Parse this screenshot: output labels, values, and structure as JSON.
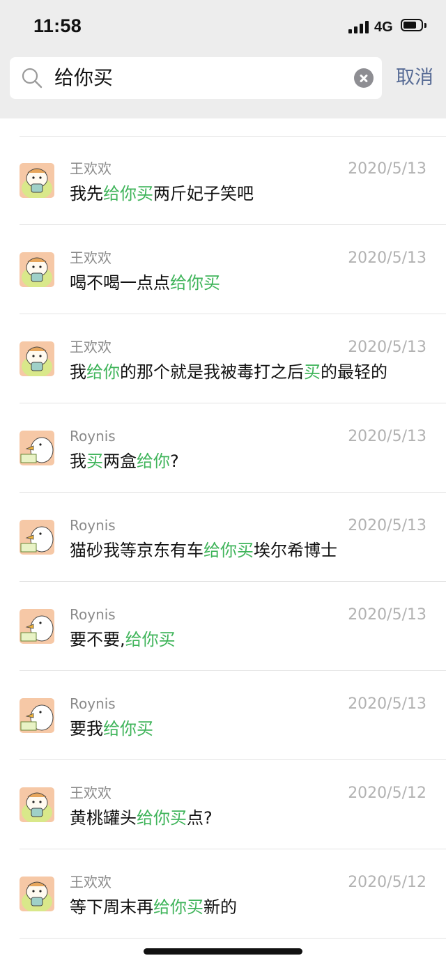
{
  "status": {
    "time": "11:58",
    "network": "4G"
  },
  "search": {
    "query": "给你买",
    "cancel_label": "取消"
  },
  "results": [
    {
      "sender": "王欢欢",
      "avatar": "hamster-avatar",
      "date": "2020/5/13",
      "segments": [
        {
          "t": "我先",
          "h": false
        },
        {
          "t": "给你买",
          "h": true
        },
        {
          "t": "两斤妃子笑吧",
          "h": false
        }
      ]
    },
    {
      "sender": "王欢欢",
      "avatar": "hamster-avatar",
      "date": "2020/5/13",
      "segments": [
        {
          "t": "喝不喝一点点",
          "h": false
        },
        {
          "t": "给你买",
          "h": true
        }
      ]
    },
    {
      "sender": "王欢欢",
      "avatar": "hamster-avatar",
      "date": "2020/5/13",
      "segments": [
        {
          "t": "我",
          "h": false
        },
        {
          "t": "给你",
          "h": true
        },
        {
          "t": "的那个就是我被毒打之后",
          "h": false
        },
        {
          "t": "买",
          "h": true
        },
        {
          "t": "的最轻的",
          "h": false
        }
      ]
    },
    {
      "sender": "Roynis",
      "avatar": "duck-avatar",
      "date": "2020/5/13",
      "segments": [
        {
          "t": "我",
          "h": false
        },
        {
          "t": "买",
          "h": true
        },
        {
          "t": "两盒",
          "h": false
        },
        {
          "t": "给你",
          "h": true
        },
        {
          "t": "?",
          "h": false
        }
      ]
    },
    {
      "sender": "Roynis",
      "avatar": "duck-avatar",
      "date": "2020/5/13",
      "segments": [
        {
          "t": "猫砂我等京东有车",
          "h": false
        },
        {
          "t": "给你买",
          "h": true
        },
        {
          "t": "埃尔希博士",
          "h": false
        }
      ]
    },
    {
      "sender": "Roynis",
      "avatar": "duck-avatar",
      "date": "2020/5/13",
      "segments": [
        {
          "t": "要不要,",
          "h": false
        },
        {
          "t": "给你买",
          "h": true
        }
      ]
    },
    {
      "sender": "Roynis",
      "avatar": "duck-avatar",
      "date": "2020/5/13",
      "segments": [
        {
          "t": "要我",
          "h": false
        },
        {
          "t": "给你买",
          "h": true
        }
      ]
    },
    {
      "sender": "王欢欢",
      "avatar": "hamster-avatar",
      "date": "2020/5/12",
      "segments": [
        {
          "t": "黄桃罐头",
          "h": false
        },
        {
          "t": "给你买",
          "h": true
        },
        {
          "t": "点?",
          "h": false
        }
      ]
    },
    {
      "sender": "王欢欢",
      "avatar": "hamster-avatar",
      "date": "2020/5/12",
      "segments": [
        {
          "t": "等下周末再",
          "h": false
        },
        {
          "t": "给你买",
          "h": true
        },
        {
          "t": "新的",
          "h": false
        }
      ]
    }
  ],
  "colors": {
    "highlight": "#3fb45a",
    "cancel": "#576b95",
    "header_bg": "#ededed"
  }
}
